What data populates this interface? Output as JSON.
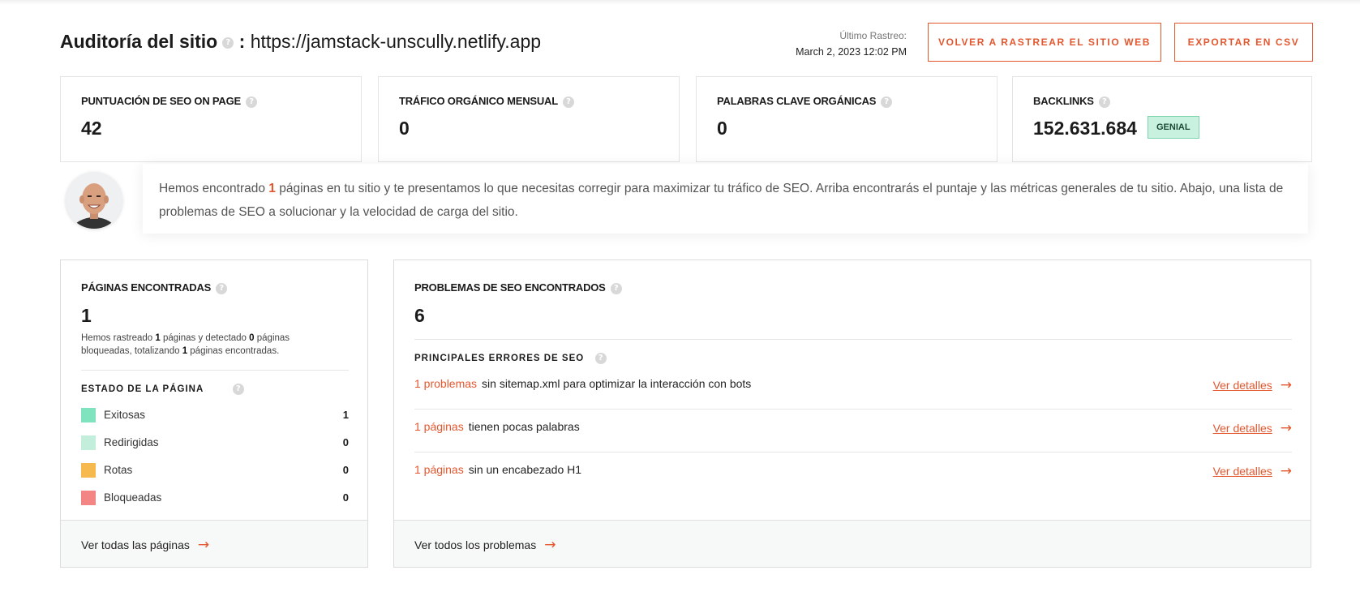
{
  "header": {
    "title_bold": "Auditoría del sitio",
    "title_sep": ":",
    "url": "https://jamstack-unscully.netlify.app",
    "last_crawl_label": "Último Rastreo:",
    "last_crawl_date": "March 2, 2023 12:02 PM",
    "recrawl_button": "VOLVER A RASTREAR EL SITIO WEB",
    "export_button": "EXPORTAR EN CSV",
    "help_glyph": "?"
  },
  "metrics": [
    {
      "label": "PUNTUACIÓN DE SEO ON PAGE",
      "value": "42"
    },
    {
      "label": "TRÁFICO ORGÁNICO MENSUAL",
      "value": "0"
    },
    {
      "label": "PALABRAS CLAVE ORGÁNICAS",
      "value": "0"
    },
    {
      "label": "BACKLINKS",
      "value": "152.631.684",
      "badge": "GENIAL"
    }
  ],
  "intro": {
    "prefix": "Hemos encontrado ",
    "count": "1",
    "suffix": " páginas en tu sitio y te presentamos lo que necesitas corregir para maximizar tu tráfico de SEO. Arriba encontrarás el puntaje y las métricas generales de tu sitio. Abajo, una lista de problemas de SEO a solucionar y la velocidad de carga del sitio."
  },
  "pages_panel": {
    "title": "PÁGINAS ENCONTRADAS",
    "value": "1",
    "desc_1": "Hemos rastreado ",
    "desc_crawled": "1",
    "desc_2": " páginas y detectado ",
    "desc_blocked": "0",
    "desc_3": " páginas bloqueadas, totalizando ",
    "desc_total": "1",
    "desc_4": " páginas encontradas.",
    "status_title": "ESTADO DE LA PÁGINA",
    "statuses": [
      {
        "name": "Exitosas",
        "count": "1",
        "color": "#7fe3c0"
      },
      {
        "name": "Redirigidas",
        "count": "0",
        "color": "#c3eedc"
      },
      {
        "name": "Rotas",
        "count": "0",
        "color": "#f5b94e"
      },
      {
        "name": "Bloqueadas",
        "count": "0",
        "color": "#f48585"
      }
    ],
    "footer_link": "Ver todas las páginas"
  },
  "issues_panel": {
    "title": "PROBLEMAS DE SEO ENCONTRADOS",
    "value": "6",
    "subtitle": "PRINCIPALES ERRORES DE SEO",
    "issues": [
      {
        "count": "1 problemas",
        "text": "sin sitemap.xml para optimizar la interacción con bots",
        "link": "Ver detalles"
      },
      {
        "count": "1 páginas",
        "text": "tienen pocas palabras",
        "link": "Ver detalles"
      },
      {
        "count": "1 páginas",
        "text": "sin un encabezado H1",
        "link": "Ver detalles"
      }
    ],
    "footer_link": "Ver todos los problemas"
  },
  "colors": {
    "accent": "#e4572e",
    "badge_bg": "#c9f1df"
  },
  "icons": {
    "help": "question-circle-icon",
    "arrow": "arrow-right-icon"
  }
}
